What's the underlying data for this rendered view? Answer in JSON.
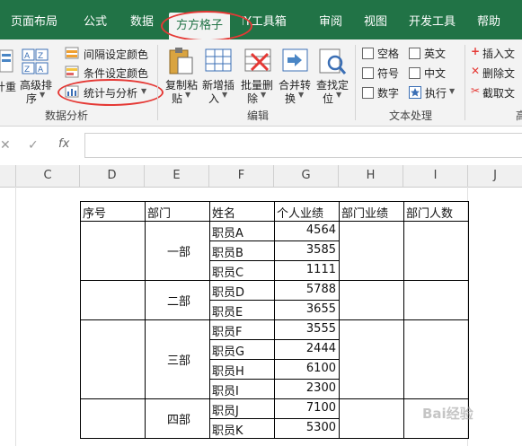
{
  "ribbon_tabs": [
    "页面布局",
    "公式",
    "数据",
    "方方格子",
    "DIY工具箱",
    "审阅",
    "视图",
    "开发工具",
    "帮助"
  ],
  "data_analysis_group": {
    "btn_partial": "计重",
    "sort_label1": "高级排",
    "sort_label2": "序",
    "interval_color": "间隔设定颜色",
    "cond_color": "条件设定颜色",
    "stats": "统计与分析",
    "label": "数据分析"
  },
  "edit_group": {
    "copy_paste": [
      "复制粘",
      "贴"
    ],
    "new_insert": [
      "新增插",
      "入"
    ],
    "batch_delete": [
      "批量删",
      "除"
    ],
    "merge_convert": [
      "合并转",
      "换"
    ],
    "find_locate": [
      "查找定",
      "位"
    ],
    "label": "编辑"
  },
  "text_group": {
    "space": "空格",
    "english": "英文",
    "symbol": "符号",
    "chinese": "中文",
    "number": "数字",
    "execute": "执行",
    "label": "文本处理"
  },
  "right_group": {
    "insert_text": "插入文",
    "delete_text": "删除文",
    "cut_text": "截取文",
    "partial_label": "高"
  },
  "formula_bar": {
    "fx": "fx"
  },
  "columns": [
    "C",
    "D",
    "E",
    "F",
    "G",
    "H",
    "I",
    "J"
  ],
  "table": {
    "headers": [
      "序号",
      "部门",
      "姓名",
      "个人业绩",
      "部门业绩",
      "部门人数"
    ],
    "departments": [
      "一部",
      "二部",
      "三部",
      "四部"
    ],
    "employees": [
      "职员A",
      "职员B",
      "职员C",
      "职员D",
      "职员E",
      "职员F",
      "职员G",
      "职员H",
      "职员I",
      "职员J",
      "职员K"
    ],
    "scores": [
      "4564",
      "3585",
      "1111",
      "5788",
      "3655",
      "3555",
      "2444",
      "6100",
      "2300",
      "7100",
      "5300"
    ]
  },
  "watermark": "Bai经验"
}
